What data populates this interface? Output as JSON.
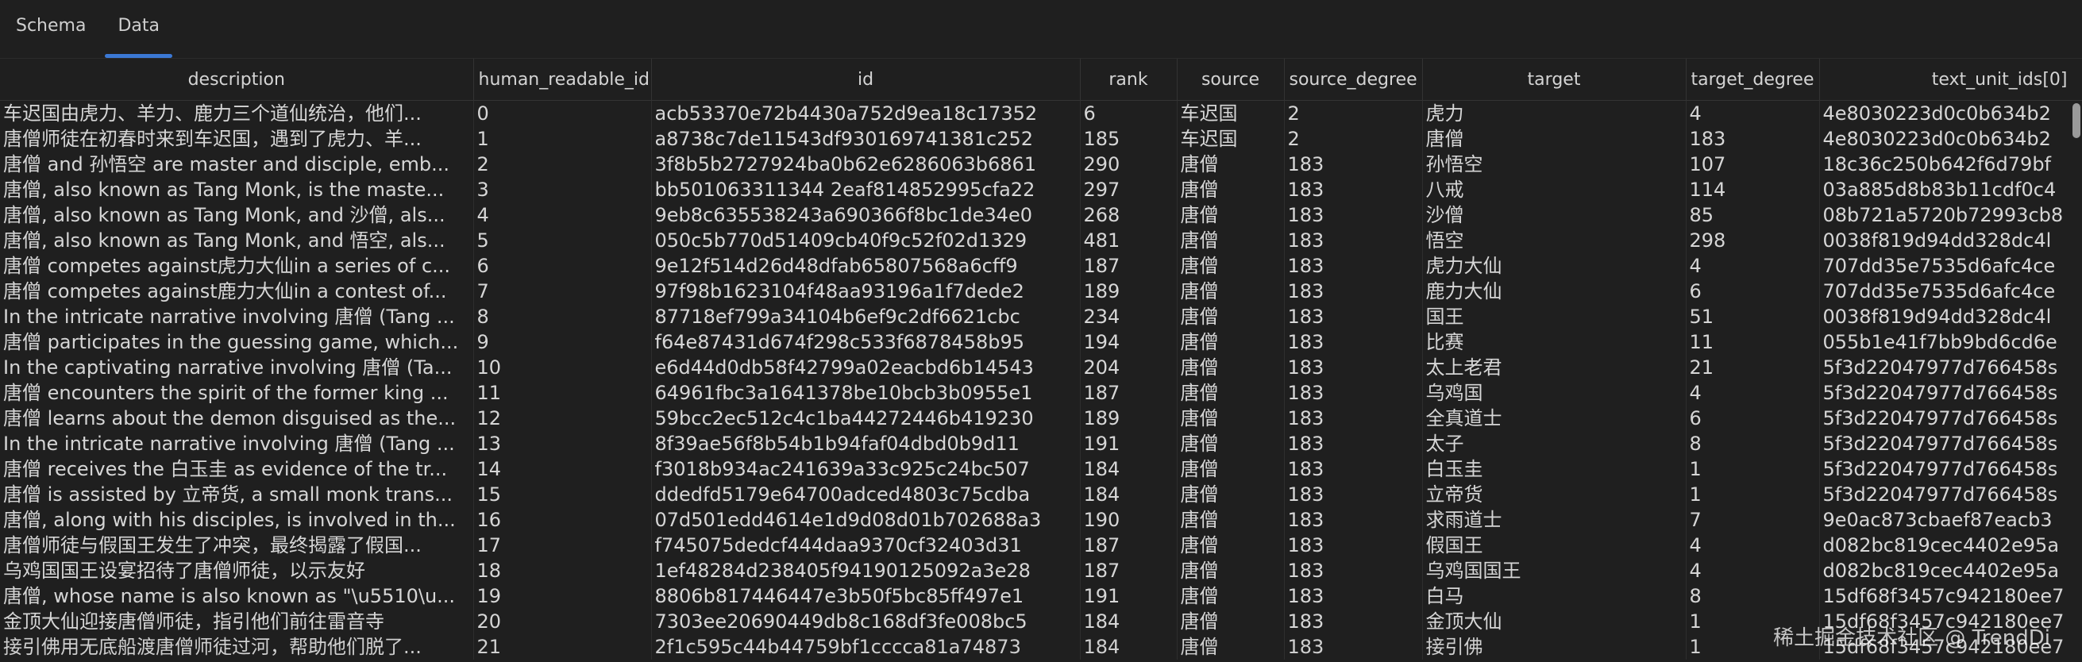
{
  "tabs": [
    {
      "label": "Schema",
      "active": false
    },
    {
      "label": "Data",
      "active": true
    }
  ],
  "columns": [
    "description",
    "human_readable_id",
    "id",
    "rank",
    "source",
    "source_degree",
    "target",
    "target_degree",
    "text_unit_ids[0]"
  ],
  "rows": [
    {
      "description": "车迟国由虎力、羊力、鹿力三个道仙统治，他们...",
      "human_readable_id": "0",
      "id": "acb53370e72b4430a752d9ea18c17352",
      "rank": "6",
      "source": "车迟国",
      "source_degree": "2",
      "target": "虎力",
      "target_degree": "4",
      "text_unit_ids": "4e8030223d0c0b634b2"
    },
    {
      "description": "唐僧师徒在初春时来到车迟国，遇到了虎力、羊...",
      "human_readable_id": "1",
      "id": "a8738c7de11543df930169741381c252",
      "rank": "185",
      "source": "车迟国",
      "source_degree": "2",
      "target": "唐僧",
      "target_degree": "183",
      "text_unit_ids": "4e8030223d0c0b634b2"
    },
    {
      "description": "唐僧 and 孙悟空 are master and disciple, emb...",
      "human_readable_id": "2",
      "id": "3f8b5b2727924ba0b62e6286063b6861",
      "rank": "290",
      "source": "唐僧",
      "source_degree": "183",
      "target": "孙悟空",
      "target_degree": "107",
      "text_unit_ids": "18c36c250b642f6d79bf"
    },
    {
      "description": "唐僧, also known as Tang Monk, is the maste...",
      "human_readable_id": "3",
      "id": "bb501063311344 2eaf814852995cfa22",
      "rank": "297",
      "source": "唐僧",
      "source_degree": "183",
      "target": "八戒",
      "target_degree": "114",
      "text_unit_ids": "03a885d8b83b11cdf0c4"
    },
    {
      "description": "唐僧, also known as Tang Monk, and 沙僧, als...",
      "human_readable_id": "4",
      "id": "9eb8c635538243a690366f8bc1de34e0",
      "rank": "268",
      "source": "唐僧",
      "source_degree": "183",
      "target": "沙僧",
      "target_degree": "85",
      "text_unit_ids": "08b721a5720b72993cb8"
    },
    {
      "description": "唐僧, also known as Tang Monk, and 悟空, als...",
      "human_readable_id": "5",
      "id": "050c5b770d51409cb40f9c52f02d1329",
      "rank": "481",
      "source": "唐僧",
      "source_degree": "183",
      "target": "悟空",
      "target_degree": "298",
      "text_unit_ids": "0038f819d94dd328dc4l"
    },
    {
      "description": "唐僧 competes against虎力大仙in a series of c...",
      "human_readable_id": "6",
      "id": "9e12f514d26d48dfab65807568a6cff9",
      "rank": "187",
      "source": "唐僧",
      "source_degree": "183",
      "target": "虎力大仙",
      "target_degree": "4",
      "text_unit_ids": "707dd35e7535d6afc4ce"
    },
    {
      "description": "唐僧 competes against鹿力大仙in a contest of...",
      "human_readable_id": "7",
      "id": "97f98b1623104f48aa93196a1f7dede2",
      "rank": "189",
      "source": "唐僧",
      "source_degree": "183",
      "target": "鹿力大仙",
      "target_degree": "6",
      "text_unit_ids": "707dd35e7535d6afc4ce"
    },
    {
      "description": "In the intricate narrative involving 唐僧 (Tang ...",
      "human_readable_id": "8",
      "id": "87718ef799a34104b6ef9c2df6621cbc",
      "rank": "234",
      "source": "唐僧",
      "source_degree": "183",
      "target": "国王",
      "target_degree": "51",
      "text_unit_ids": "0038f819d94dd328dc4l"
    },
    {
      "description": "唐僧 participates in the guessing game, which...",
      "human_readable_id": "9",
      "id": "f64e87431d674f298c533f6878458b95",
      "rank": "194",
      "source": "唐僧",
      "source_degree": "183",
      "target": "比赛",
      "target_degree": "11",
      "text_unit_ids": "055b1e41f7bb9bd6cd6e"
    },
    {
      "description": "In the captivating narrative involving 唐僧 (Ta...",
      "human_readable_id": "10",
      "id": "e6d44d0db58f42799a02eacbd6b14543",
      "rank": "204",
      "source": "唐僧",
      "source_degree": "183",
      "target": "太上老君",
      "target_degree": "21",
      "text_unit_ids": "5f3d22047977d766458s"
    },
    {
      "description": "唐僧 encounters the spirit of the former king ...",
      "human_readable_id": "11",
      "id": "64961fbc3a1641378be10bcb3b0955e1",
      "rank": "187",
      "source": "唐僧",
      "source_degree": "183",
      "target": "乌鸡国",
      "target_degree": "4",
      "text_unit_ids": "5f3d22047977d766458s"
    },
    {
      "description": "唐僧 learns about the demon disguised as the...",
      "human_readable_id": "12",
      "id": "59bcc2ec512c4c1ba44272446b419230",
      "rank": "189",
      "source": "唐僧",
      "source_degree": "183",
      "target": "全真道士",
      "target_degree": "6",
      "text_unit_ids": "5f3d22047977d766458s"
    },
    {
      "description": "In the intricate narrative involving 唐僧 (Tang ...",
      "human_readable_id": "13",
      "id": "8f39ae56f8b54b1b94faf04dbd0b9d11",
      "rank": "191",
      "source": "唐僧",
      "source_degree": "183",
      "target": "太子",
      "target_degree": "8",
      "text_unit_ids": "5f3d22047977d766458s"
    },
    {
      "description": "唐僧 receives the 白玉圭 as evidence of the tr...",
      "human_readable_id": "14",
      "id": "f3018b934ac241639a33c925c24bc507",
      "rank": "184",
      "source": "唐僧",
      "source_degree": "183",
      "target": "白玉圭",
      "target_degree": "1",
      "text_unit_ids": "5f3d22047977d766458s"
    },
    {
      "description": "唐僧 is assisted by 立帝货, a small monk trans...",
      "human_readable_id": "15",
      "id": "ddedfd5179e64700adced4803c75cdba",
      "rank": "184",
      "source": "唐僧",
      "source_degree": "183",
      "target": "立帝货",
      "target_degree": "1",
      "text_unit_ids": "5f3d22047977d766458s"
    },
    {
      "description": "唐僧, along with his disciples, is involved in th...",
      "human_readable_id": "16",
      "id": "07d501edd4614e1d9d08d01b702688a3",
      "rank": "190",
      "source": "唐僧",
      "source_degree": "183",
      "target": "求雨道士",
      "target_degree": "7",
      "text_unit_ids": "9e0ac873cbaef87eacb3"
    },
    {
      "description": "唐僧师徒与假国王发生了冲突，最终揭露了假国...",
      "human_readable_id": "17",
      "id": "f745075dedcf444daa9370cf32403d31",
      "rank": "187",
      "source": "唐僧",
      "source_degree": "183",
      "target": "假国王",
      "target_degree": "4",
      "text_unit_ids": "d082bc819cec4402e95a"
    },
    {
      "description": "乌鸡国国王设宴招待了唐僧师徒，以示友好",
      "human_readable_id": "18",
      "id": "1ef48284d238405f94190125092a3e28",
      "rank": "187",
      "source": "唐僧",
      "source_degree": "183",
      "target": "乌鸡国国王",
      "target_degree": "4",
      "text_unit_ids": "d082bc819cec4402e95a"
    },
    {
      "description": "唐僧, whose name is also known as \"\\u5510\\u...",
      "human_readable_id": "19",
      "id": "8806b817446447e3b50f5bc85ff497e1",
      "rank": "191",
      "source": "唐僧",
      "source_degree": "183",
      "target": "白马",
      "target_degree": "8",
      "text_unit_ids": "15df68f3457c942180ee7"
    },
    {
      "description": "金顶大仙迎接唐僧师徒，指引他们前往雷音寺",
      "human_readable_id": "20",
      "id": "7303ee20690449db8c168df3fe008bc5",
      "rank": "184",
      "source": "唐僧",
      "source_degree": "183",
      "target": "金顶大仙",
      "target_degree": "1",
      "text_unit_ids": "15df68f3457c942180ee7"
    },
    {
      "description": "接引佛用无底船渡唐僧师徒过河，帮助他们脱了...",
      "human_readable_id": "21",
      "id": "2f1c595c44b44759bf1cccca81a74873",
      "rank": "184",
      "source": "唐僧",
      "source_degree": "183",
      "target": "接引佛",
      "target_degree": "1",
      "text_unit_ids": "15df68f3457c942180ee7"
    }
  ],
  "watermark": "稀土掘金技术社区 @ TrendDi"
}
